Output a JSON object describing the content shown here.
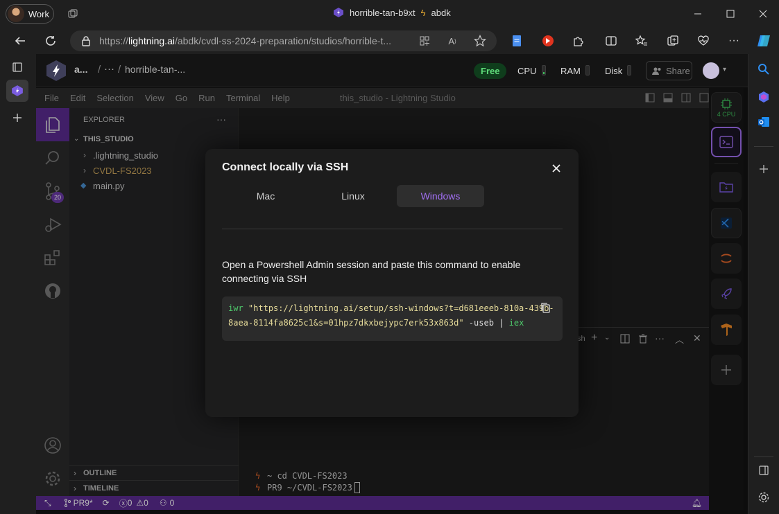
{
  "browser": {
    "profile_label": "Work",
    "tab_title": "horrible-tan-b9xt",
    "tab_sub": "abdk",
    "url_scheme": "https://",
    "url_host": "lightning.ai",
    "url_path": "/abdk/cvdl-ss-2024-preparation/studios/horrible-t..."
  },
  "lightning": {
    "breadcrumb_owner": "a...",
    "breadcrumb_sep": "/",
    "breadcrumb_more": "···",
    "breadcrumb_studio": "horrible-tan-...",
    "plan_badge": "Free",
    "cpu_label": "CPU",
    "ram_label": "RAM",
    "disk_label": "Disk",
    "share_label": "Share",
    "cpu_chip": "4 CPU"
  },
  "vscode": {
    "menu": [
      "File",
      "Edit",
      "Selection",
      "View",
      "Go",
      "Run",
      "Terminal",
      "Help"
    ],
    "window_title": "this_studio - Lightning Studio",
    "explorer_title": "EXPLORER",
    "explorer_more": "···",
    "root_folder": "THIS_STUDIO",
    "items": [
      ".lightning_studio",
      "CVDL-FS2023",
      "main.py"
    ],
    "scm_badge": "20",
    "outline": "OUTLINE",
    "timeline": "TIMELINE",
    "terminal_tab": "sh",
    "terminal_lines": [
      "~ cd CVDL-FS2023",
      "PR9 ~/CVDL-FS2023"
    ],
    "status": {
      "branch": "PR9*",
      "errors": "0",
      "warnings": "0",
      "ports": "0"
    }
  },
  "modal": {
    "title": "Connect locally via SSH",
    "tabs": [
      "Mac",
      "Linux",
      "Windows"
    ],
    "active_tab": "Windows",
    "description": "Open a Powershell Admin session and paste this command to enable connecting via SSH",
    "cmd_keyword": "iwr",
    "cmd_url_line1": "\"https://lightning.ai/setup/ssh-windows?t=d681eeeb-810a-439b-",
    "cmd_url_line2": "8aea-8114fa8625c1&s=01hpz7dkxbejypc7erk53x863d\"",
    "cmd_flag": "-useb",
    "cmd_pipe": "|",
    "cmd_tail": "iex"
  },
  "colors": {
    "accent": "#a16ff2",
    "status_bar": "#5b2c91",
    "free_badge": "#0f3d1c"
  }
}
